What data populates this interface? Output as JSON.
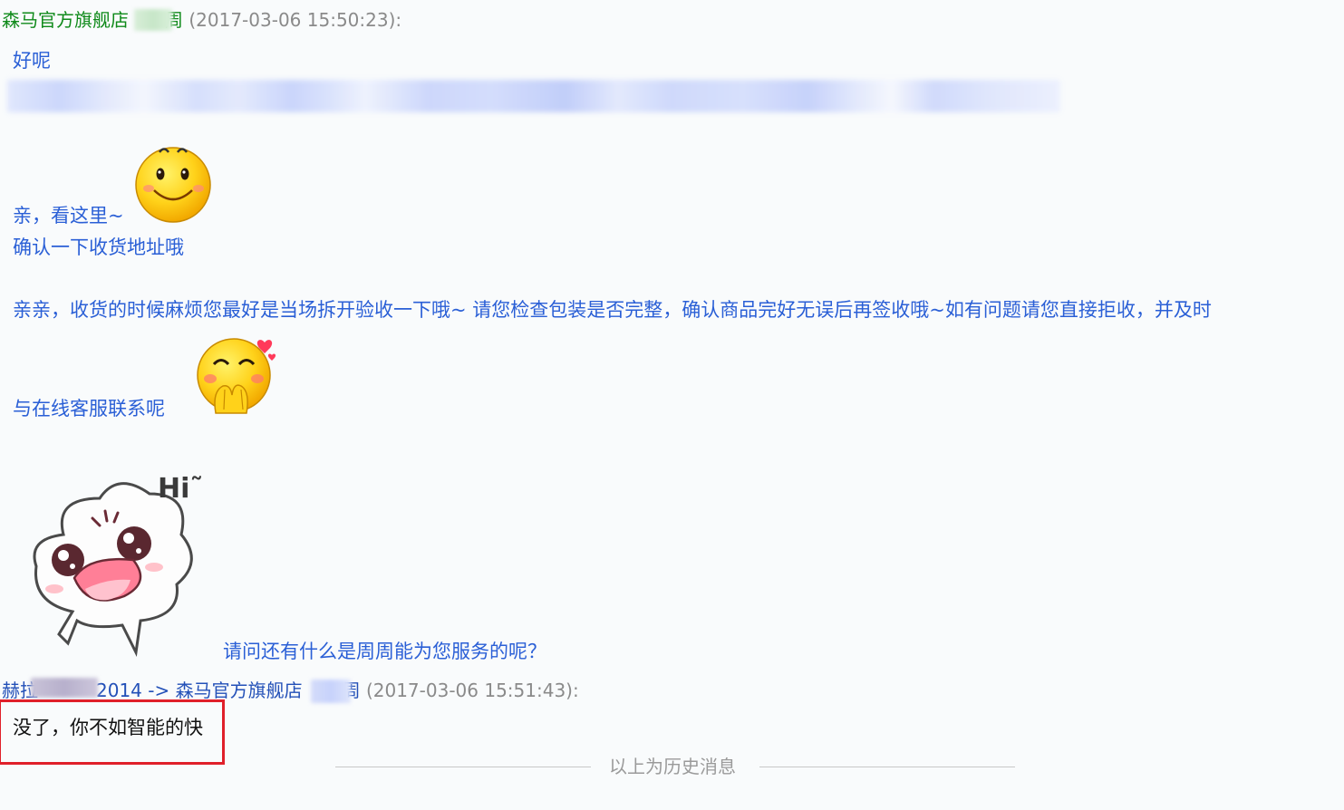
{
  "chat": {
    "message1": {
      "sender_prefix": "森马官方旗舰店",
      "sender_suffix": "周",
      "timestamp": "(2017-03-06 15:50:23):",
      "lines": [
        "好呢",
        "亲，看这里~",
        "确认一下收货地址哦",
        "亲亲，收货的时候麻烦您最好是当场拆开验收一下哦~ 请您检查包装是否完整，确认商品完好无误后再签收哦~如有问题请您直接拒收，并及时",
        "与在线客服联系呢",
        "请问还有什么是周周能为您服务的呢？"
      ],
      "sticker_text": "Hi˜",
      "emojis": [
        "smile-emoji-icon",
        "shy-emoji-icon",
        "hi-sticker-icon"
      ]
    },
    "message2": {
      "sender_prefix": "赫拉",
      "sender_mid": "2014 -> 森马官方旗舰店",
      "sender_suffix": "周",
      "timestamp": "(2017-03-06 15:51:43):",
      "text": "没了，你不如智能的快"
    },
    "divider": "以上为历史消息"
  },
  "colors": {
    "seller_name": "#0f8a1a",
    "buyer_name": "#2350b8",
    "message_text": "#2a5fd6",
    "timestamp": "#8a8a8a",
    "highlight_border": "#e0202a",
    "background": "#f9fbfc"
  }
}
